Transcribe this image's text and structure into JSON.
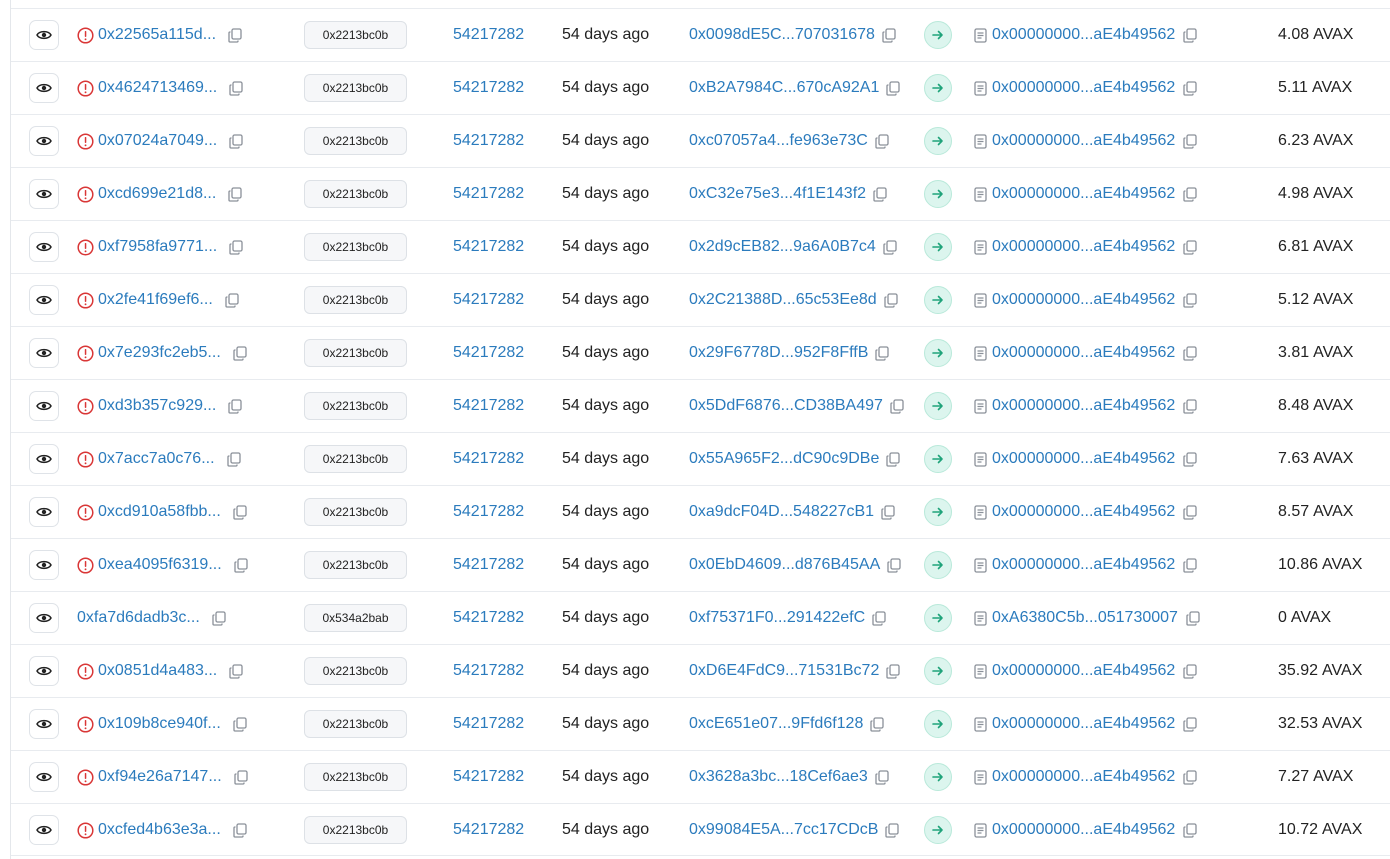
{
  "colors": {
    "link": "#2b7bbd",
    "error": "#d93636",
    "direction_bg": "#dcf5ee",
    "direction_arrow": "#1fa37a",
    "badge_bg": "#f6f7f9"
  },
  "icons": {
    "view": "eye-icon",
    "status_failed": "error-circle-icon",
    "copy": "copy-icon",
    "direction": "arrow-right-icon",
    "contract": "contract-document-icon"
  },
  "currency": "AVAX",
  "transactions": [
    {
      "hash": "0x22565a115d...",
      "failed": true,
      "method": "0x2213bc0b",
      "block": "54217282",
      "age": "54 days ago",
      "from": "0x0098dE5C...707031678",
      "to": "0x00000000...aE4b49562",
      "value": "4.08"
    },
    {
      "hash": "0x4624713469...",
      "failed": true,
      "method": "0x2213bc0b",
      "block": "54217282",
      "age": "54 days ago",
      "from": "0xB2A7984C...670cA92A1",
      "to": "0x00000000...aE4b49562",
      "value": "5.11"
    },
    {
      "hash": "0x07024a7049...",
      "failed": true,
      "method": "0x2213bc0b",
      "block": "54217282",
      "age": "54 days ago",
      "from": "0xc07057a4...fe963e73C",
      "to": "0x00000000...aE4b49562",
      "value": "6.23"
    },
    {
      "hash": "0xcd699e21d8...",
      "failed": true,
      "method": "0x2213bc0b",
      "block": "54217282",
      "age": "54 days ago",
      "from": "0xC32e75e3...4f1E143f2",
      "to": "0x00000000...aE4b49562",
      "value": "4.98"
    },
    {
      "hash": "0xf7958fa9771...",
      "failed": true,
      "method": "0x2213bc0b",
      "block": "54217282",
      "age": "54 days ago",
      "from": "0x2d9cEB82...9a6A0B7c4",
      "to": "0x00000000...aE4b49562",
      "value": "6.81"
    },
    {
      "hash": "0x2fe41f69ef6...",
      "failed": true,
      "method": "0x2213bc0b",
      "block": "54217282",
      "age": "54 days ago",
      "from": "0x2C21388D...65c53Ee8d",
      "to": "0x00000000...aE4b49562",
      "value": "5.12"
    },
    {
      "hash": "0x7e293fc2eb5...",
      "failed": true,
      "method": "0x2213bc0b",
      "block": "54217282",
      "age": "54 days ago",
      "from": "0x29F6778D...952F8FffB",
      "to": "0x00000000...aE4b49562",
      "value": "3.81"
    },
    {
      "hash": "0xd3b357c929...",
      "failed": true,
      "method": "0x2213bc0b",
      "block": "54217282",
      "age": "54 days ago",
      "from": "0x5DdF6876...CD38BA497",
      "to": "0x00000000...aE4b49562",
      "value": "8.48"
    },
    {
      "hash": "0x7acc7a0c76...",
      "failed": true,
      "method": "0x2213bc0b",
      "block": "54217282",
      "age": "54 days ago",
      "from": "0x55A965F2...dC90c9DBe",
      "to": "0x00000000...aE4b49562",
      "value": "7.63"
    },
    {
      "hash": "0xcd910a58fbb...",
      "failed": true,
      "method": "0x2213bc0b",
      "block": "54217282",
      "age": "54 days ago",
      "from": "0xa9dcF04D...548227cB1",
      "to": "0x00000000...aE4b49562",
      "value": "8.57"
    },
    {
      "hash": "0xea4095f6319...",
      "failed": true,
      "method": "0x2213bc0b",
      "block": "54217282",
      "age": "54 days ago",
      "from": "0x0EbD4609...d876B45AA",
      "to": "0x00000000...aE4b49562",
      "value": "10.86"
    },
    {
      "hash": "0xfa7d6dadb3c...",
      "failed": false,
      "method": "0x534a2bab",
      "block": "54217282",
      "age": "54 days ago",
      "from": "0xf75371F0...291422efC",
      "to": "0xA6380C5b...051730007",
      "value": "0"
    },
    {
      "hash": "0x0851d4a483...",
      "failed": true,
      "method": "0x2213bc0b",
      "block": "54217282",
      "age": "54 days ago",
      "from": "0xD6E4FdC9...71531Bc72",
      "to": "0x00000000...aE4b49562",
      "value": "35.92"
    },
    {
      "hash": "0x109b8ce940f...",
      "failed": true,
      "method": "0x2213bc0b",
      "block": "54217282",
      "age": "54 days ago",
      "from": "0xcE651e07...9Ffd6f128",
      "to": "0x00000000...aE4b49562",
      "value": "32.53"
    },
    {
      "hash": "0xf94e26a7147...",
      "failed": true,
      "method": "0x2213bc0b",
      "block": "54217282",
      "age": "54 days ago",
      "from": "0x3628a3bc...18Cef6ae3",
      "to": "0x00000000...aE4b49562",
      "value": "7.27"
    },
    {
      "hash": "0xcfed4b63e3a...",
      "failed": true,
      "method": "0x2213bc0b",
      "block": "54217282",
      "age": "54 days ago",
      "from": "0x99084E5A...7cc17CDcB",
      "to": "0x00000000...aE4b49562",
      "value": "10.72"
    }
  ]
}
